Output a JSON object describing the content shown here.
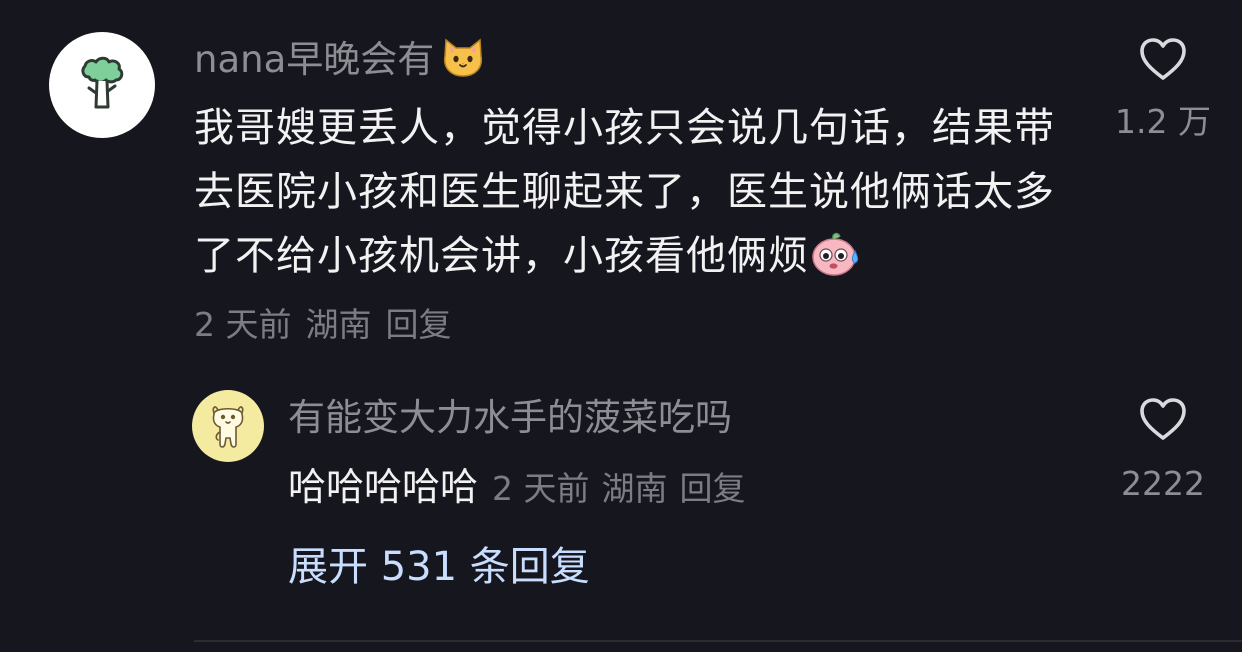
{
  "comment": {
    "username": "nana早晚会有",
    "username_emoji": "cat-face-icon",
    "text": "我哥嫂更丢人，觉得小孩只会说几句话，结果带去医院小孩和医生聊起来了，医生说他俩话太多了不给小孩机会讲，小孩看他俩烦",
    "text_emoji": "sweating-pink-face-icon",
    "time": "2 天前",
    "location": "湖南",
    "reply_label": "回复",
    "likes": "1.2 万",
    "avatar_icon": "broccoli-icon"
  },
  "reply": {
    "username": "有能变大力水手的菠菜吃吗",
    "text": "哈哈哈哈哈",
    "time": "2 天前",
    "location": "湖南",
    "reply_label": "回复",
    "likes": "2222",
    "avatar_icon": "cartoon-dog-icon"
  },
  "expand": {
    "label": "展开 531 条回复"
  },
  "colors": {
    "background": "#16161e",
    "primary_text": "#f2f2f2",
    "secondary_text": "#8d8d94",
    "link_text": "#c9ddff",
    "reply_avatar_bg": "#f4eba0"
  }
}
